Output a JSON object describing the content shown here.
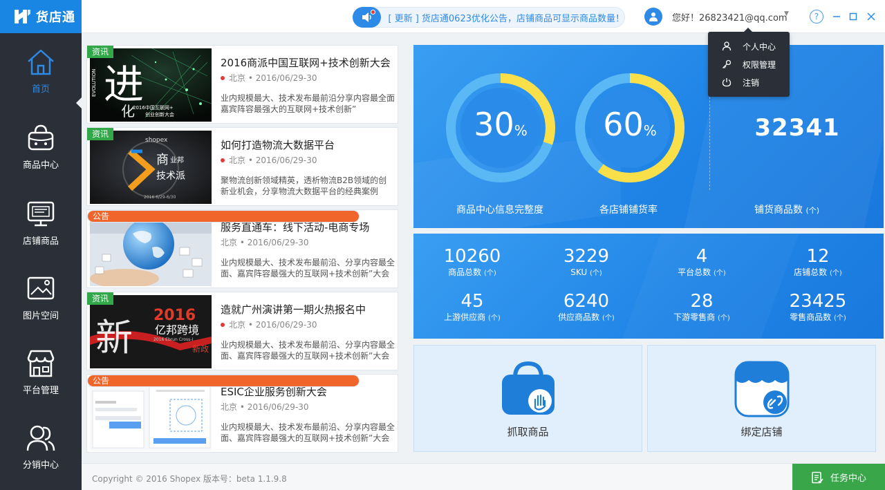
{
  "app": {
    "logo_text": "货店通"
  },
  "topbar": {
    "notice_text": "[ 更新 ] 货店通0623优化公告，店铺商品可显示商品数量！",
    "greeting": "您好！26823421@qq.com"
  },
  "user_menu": {
    "items": [
      {
        "label": "个人中心",
        "icon": "user-icon"
      },
      {
        "label": "权限管理",
        "icon": "key-icon"
      },
      {
        "label": "注销",
        "icon": "power-icon"
      }
    ]
  },
  "sidebar": {
    "items": [
      {
        "label": "首页",
        "icon": "home-icon",
        "active": true
      },
      {
        "label": "商品中心",
        "icon": "basket-icon"
      },
      {
        "label": "店铺商品",
        "icon": "monitor-icon"
      },
      {
        "label": "图片空间",
        "icon": "image-icon"
      },
      {
        "label": "平台管理",
        "icon": "storefront-icon"
      },
      {
        "label": "分销中心",
        "icon": "people-icon"
      }
    ]
  },
  "news": [
    {
      "badge": "资讯",
      "title": "2016商派中国互联网+技术创新大会",
      "location": "北京",
      "date": "2016/06/29-30",
      "desc": "业内规模最大、技术发布最前沿分享内容最全面嘉宾阵容最强大的互联网+技术创新”",
      "hot": true
    },
    {
      "badge": "资讯",
      "title": "如何打造物流大数据平台",
      "location": "北京",
      "date": "2016/06/29-30",
      "desc": "聚物流创新领域精英，透析物流B2B领域的创新业机会，分享物流大数据平台的经典案例",
      "hot": true
    },
    {
      "badge": "公告",
      "title": "服务直通车：线下活动-电商专场",
      "location": "北京",
      "date": "2016/06/29-30",
      "desc": "业内规模最大、技术发布最前沿、分享内容最全面、嘉宾阵容最强大的互联网+技术创新”大会",
      "hot": false
    },
    {
      "badge": "资讯",
      "title": "造就广州演讲第一期火热报名中",
      "location": "北京",
      "date": "2016/06/29-30",
      "desc": "业内规模最大、技术发布最前沿、分享内容最全面、嘉宾阵容最强大的互联网+技术创新”大会",
      "hot": true
    },
    {
      "badge": "公告",
      "title": "ESIC企业服务创新大会",
      "location": "北京",
      "date": "2016/06/29-30",
      "desc": "业内规模最大、技术发布最前沿、分享内容最全面、嘉宾阵容最强大的互联网+技术创新”大会",
      "hot": false
    }
  ],
  "thumbs": {
    "t1_year": "2016中国互联网+",
    "t1_sub": "创业创新大会",
    "t2_brand": "shopex",
    "t2_main": "商",
    "t2_side": "业邦",
    "t2_sub": "技术派",
    "t2_date": "2016 6/29-6/30",
    "t4_year": "2016",
    "t4_name": "亿邦跨境",
    "t4_en": "2016 Ebrun Cross-I",
    "t4_tag": "新政"
  },
  "summary": {
    "completeness": {
      "value": 30,
      "unit": "%",
      "label": "商品中心信息完整度"
    },
    "stock_rate": {
      "value": 60,
      "unit": "%",
      "label": "各店铺铺货率"
    },
    "stocked_count": {
      "value": "32341",
      "label": "铺货商品数",
      "unit": "(个)"
    }
  },
  "stats": [
    {
      "value": "10260",
      "label": "商品总数",
      "unit": "(个)"
    },
    {
      "value": "3229",
      "label": "SKU",
      "unit": "(个)"
    },
    {
      "value": "4",
      "label": "平台总数",
      "unit": "(个)"
    },
    {
      "value": "12",
      "label": "店铺总数",
      "unit": "(个)"
    },
    {
      "value": "45",
      "label": "上游供应商",
      "unit": "(个)"
    },
    {
      "value": "6240",
      "label": "供应商品数",
      "unit": "(个)"
    },
    {
      "value": "28",
      "label": "下游零售商",
      "unit": "(个)"
    },
    {
      "value": "23425",
      "label": "零售商品数",
      "unit": "(个)"
    }
  ],
  "actions": {
    "grab": "抓取商品",
    "bind": "绑定店铺"
  },
  "footer": {
    "copyright": "Copyright © 2016 Shopex   版本号：beta 1.1.9.8",
    "task_center": "任务中心"
  },
  "colors": {
    "brand_blue": "#1a86e4",
    "sidebar_bg": "#2b3038",
    "badge_info": "#33a84a",
    "badge_notice": "#f0662a",
    "donut_track": "#5ab8f5",
    "donut_fill": "#f9e04a",
    "task_green": "#3aa64a"
  }
}
